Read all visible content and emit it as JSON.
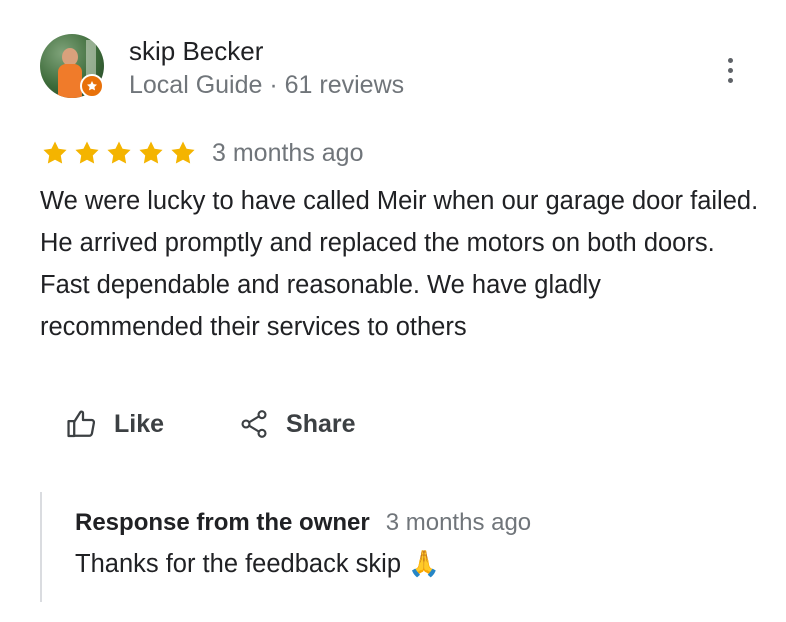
{
  "reviewer": {
    "name": "skip Becker",
    "subline": "Local Guide · 61 reviews",
    "badge_color": "#e8710a"
  },
  "review": {
    "rating": 5,
    "rating_max": 5,
    "star_color": "#f4b400",
    "time": "3 months ago",
    "text": "We were lucky to have called Meir when our garage door failed. He arrived promptly and replaced the motors on both doors. Fast dependable and reasonable. We have gladly recommended their services to others"
  },
  "actions": {
    "like_label": "Like",
    "share_label": "Share",
    "like_icon": "thumbs-up-icon",
    "share_icon": "share-icon"
  },
  "owner_response": {
    "title": "Response from the owner",
    "time": "3 months ago",
    "text": "Thanks for the feedback skip 🙏"
  },
  "menu": {
    "icon": "more-vert-icon"
  }
}
